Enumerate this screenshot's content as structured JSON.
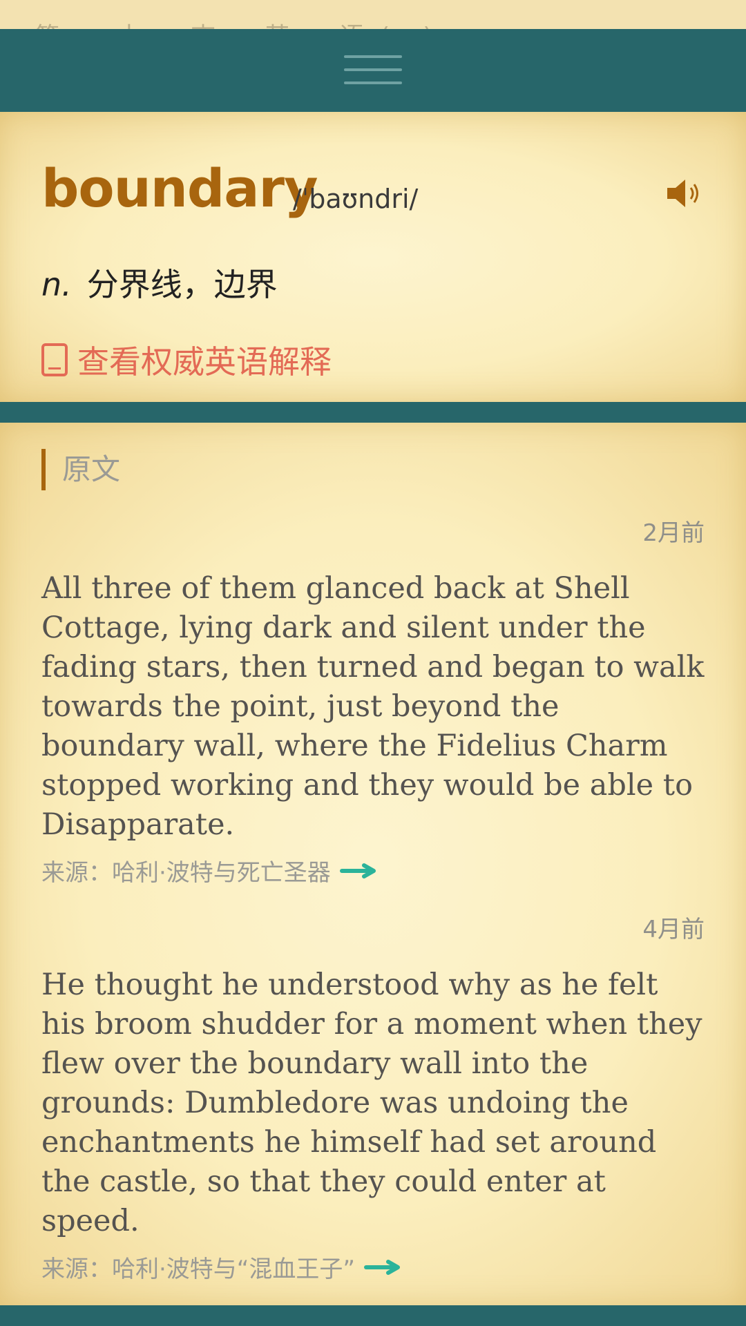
{
  "top_strip": {
    "text": "第 … 本 ▪ 查 ▪ 英 ▪ 语 (…)"
  },
  "header": {
    "menu_icon": "hamburger-handle"
  },
  "word": {
    "headword": "boundary",
    "phonetic": "/ˈbaʊndri/",
    "speaker_icon": "speaker-icon",
    "pos": "n.",
    "definition": "分界线，边界",
    "authority_link": "查看权威英语解释",
    "accent_color": "#a8650e",
    "link_color": "#e36a55"
  },
  "examples": {
    "section_title": "原文",
    "items": [
      {
        "time": "2月前",
        "sentence": "All three of them glanced back at Shell Cottage, lying dark and silent under the fading stars, then turned and began to walk towards the point, just beyond the boundary wall, where the Fidelius Charm stopped working and they would be able to Disapparate.",
        "source": "来源：哈利·波特与死亡圣器"
      },
      {
        "time": "4月前",
        "sentence": "He thought he understood why as he felt his broom shudder for a moment when they flew over the boundary wall into the grounds: Dumbledore was undoing the enchantments he himself had set around the castle, so that they could enter at speed.",
        "source": "来源：哈利·波特与“混血王子”"
      }
    ]
  },
  "colors": {
    "teal": "#27666a",
    "parchment": "#fbeebd",
    "arrow": "#2bb39a"
  }
}
